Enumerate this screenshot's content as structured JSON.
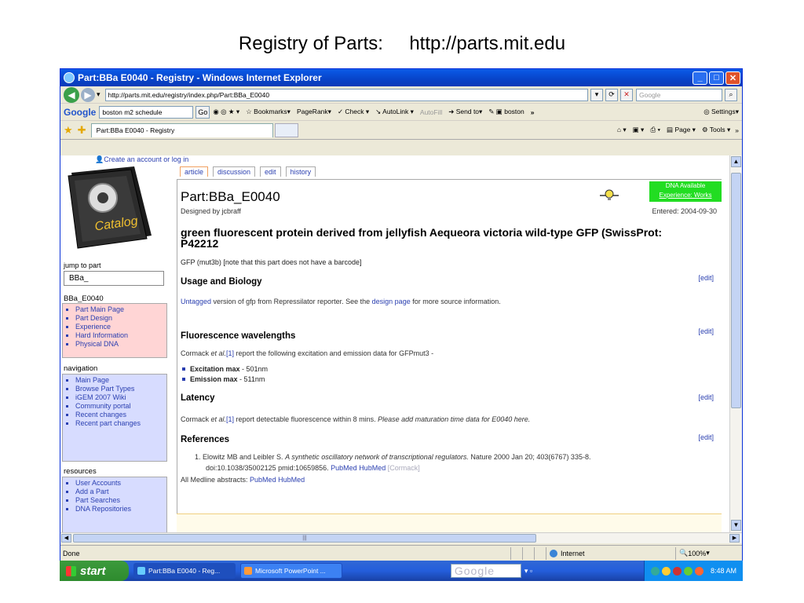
{
  "slide": {
    "title_left": "Registry of Parts:",
    "title_right": "http://parts.mit.edu"
  },
  "window": {
    "title": "Part:BBa E0040 - Registry - Windows Internet Explorer",
    "address": "http://parts.mit.edu/registry/index.php/Part:BBa_E0040",
    "search_placeholder": "Google",
    "tab_label": "Part:BBa E0040 - Registry"
  },
  "google_toolbar": {
    "logo": "Google",
    "search_value": "boston m2 schedule",
    "go_label": "Go",
    "bookmarks": "Bookmarks",
    "pagerank": "PageRank",
    "check": "Check",
    "autolink": "AutoLink",
    "autofill": "AutoFill",
    "sendto": "Send to",
    "boston": "boston",
    "more": "»",
    "settings": "Settings"
  },
  "command_bar": {
    "page": "Page",
    "tools": "Tools"
  },
  "sidebar": {
    "account_link": "Create an account or log in",
    "catalog_label": "Catalog",
    "jump_label": "jump to part",
    "jump_value": "BBa_",
    "part_head": "BBa_E0040",
    "part_items": [
      "Part Main Page",
      "Part Design",
      "Experience",
      "Hard Information",
      "Physical DNA"
    ],
    "nav_head": "navigation",
    "nav_items": [
      "Main Page",
      "Browse Part Types",
      "iGEM 2007 Wiki",
      "Community portal",
      "Recent changes",
      "Recent part changes"
    ],
    "res_head": "resources",
    "res_items": [
      "User Accounts",
      "Add a Part",
      "Part Searches",
      "DNA Repositories"
    ]
  },
  "page_tabs": [
    "article",
    "discussion",
    "edit",
    "history"
  ],
  "article": {
    "title": "Part:BBa_E0040",
    "dna_status_1": "DNA Available",
    "dna_status_2": "Experience: Works",
    "designed_by": "Designed by jcbraff",
    "entered": "Entered: 2004-09-30",
    "description": "green fluorescent protein derived from jellyfish Aequeora victoria wild-type GFP (SwissProt: P42212",
    "gfp_line": "GFP (mut3b) [note that this part does not have a barcode]",
    "edit_label": "[edit]",
    "usage_head": "Usage and Biology",
    "usage_text_1": "Untagged",
    "usage_text_2": " version of gfp from Repressilator reporter. See the ",
    "usage_text_3": "design page",
    "usage_text_4": " for more source information.",
    "fluor_head": "Fluorescence wavelengths",
    "fluor_text_1": "Cormack ",
    "fluor_text_2": "et al.",
    "fluor_text_3": "[1]",
    "fluor_text_4": " report the following excitation and emission data for GFPmut3 -",
    "excitation_label": "Excitation max",
    "excitation_value": " - 501nm",
    "emission_label": "Emission max",
    "emission_value": " - 511nm",
    "latency_head": "Latency",
    "latency_text_1": "Cormack ",
    "latency_text_2": "et al.",
    "latency_text_3": "[1]",
    "latency_text_4": " report detectable fluorescence within 8 mins. ",
    "latency_text_5": "Please add maturation time data for E0040 here.",
    "refs_head": "References",
    "ref_1_a": "1.   Elowitz MB and Leibler S. ",
    "ref_1_b": "A synthetic oscillatory network of transcriptional regulators.",
    "ref_1_c": " Nature 2000 Jan 20; 403(6767) 335-8.",
    "ref_1_d": "doi:10.1038/35002125 pmid:10659856. ",
    "ref_1_pubmed": "PubMed",
    "ref_1_hubmed": "HubMed",
    "ref_1_cormack": "[Cormack]",
    "medline": "All Medline abstracts: ",
    "medline_pubmed": "PubMed",
    "medline_hubmed": "HubMed"
  },
  "statusbar": {
    "done": "Done",
    "zone": "Internet",
    "zoom": "100%"
  },
  "taskbar": {
    "start": "start",
    "task1": "Part:BBa E0040 - Reg...",
    "task2": "Microsoft PowerPoint ...",
    "google": "Google",
    "clock": "8:48 AM"
  }
}
